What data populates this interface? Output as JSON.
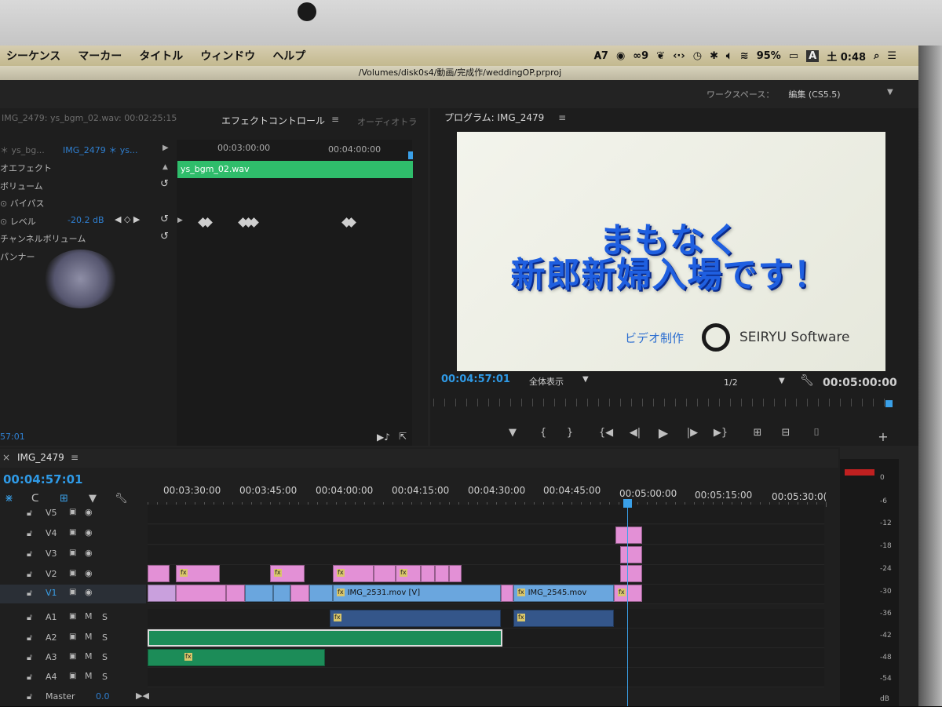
{
  "menubar": {
    "items": [
      "シーケンス",
      "マーカー",
      "タイトル",
      "ウィンドウ",
      "ヘルプ"
    ],
    "status": {
      "adobe": "7",
      "cc": "9",
      "battery": "95%",
      "input": "A",
      "clock": "土 0:48"
    }
  },
  "window_title": "/Volumes/disk0s4/動画/完成作/weddingOP.prproj",
  "workspace": {
    "label": "ワークスペース：",
    "value": "編集 (CS5.5)"
  },
  "effect_panel": {
    "source_info": "IMG_2479: ys_bgm_02.wav: 00:02:25:15",
    "tab_effect": "エフェクトコントロール",
    "tab_menu": "≡",
    "tab_audio": "オーディオトラ",
    "master_label": "＊ ys_bg...",
    "clip_label": "IMG_2479 ＊ ys...",
    "ruler": [
      "00:03:00:00",
      "00:04:00:00"
    ],
    "clip_name": "ys_bgm_02.wav",
    "rows": {
      "audio_effect": "オエフェクト",
      "volume": "ボリューム",
      "bypass": "バイパス",
      "level": "レベル",
      "level_value": "-20.2 dB",
      "channel_volume": "チャンネルボリューム",
      "panner": "パンナー"
    },
    "footer_tc": "57:01"
  },
  "program_monitor": {
    "title": "プログラム: IMG_2479",
    "headline_line1": "まもなく",
    "headline_line2": "新郎新婦入場です！",
    "credit": "ビデオ制作",
    "logo_text": "SEIRYU Software",
    "timecode": "00:04:57:01",
    "fit": "全体表示",
    "resolution": "1/2",
    "duration": "00:05:00:00"
  },
  "timeline": {
    "tab": "IMG_2479",
    "timecode": "00:04:57:01",
    "ruler": [
      "00:03:30:00",
      "00:03:45:00",
      "00:04:00:00",
      "00:04:15:00",
      "00:04:30:00",
      "00:04:45:00",
      "00:05:00:00",
      "00:05:15:00",
      "00:05:30:0("
    ],
    "video_tracks": [
      "V5",
      "V4",
      "V3",
      "V2",
      "V1"
    ],
    "audio_tracks": [
      "A1",
      "A2",
      "A3",
      "A4"
    ],
    "master": "Master",
    "master_value": "0.0",
    "clip_v1_a": "IMG_2531.mov [V]",
    "clip_v1_b": "IMG_2545.mov",
    "mute": "M",
    "solo": "S"
  },
  "meter": {
    "labels": [
      "0",
      "-6",
      "-12",
      "-18",
      "-24",
      "-30",
      "-36",
      "-42",
      "-48",
      "-54",
      "dB"
    ]
  }
}
